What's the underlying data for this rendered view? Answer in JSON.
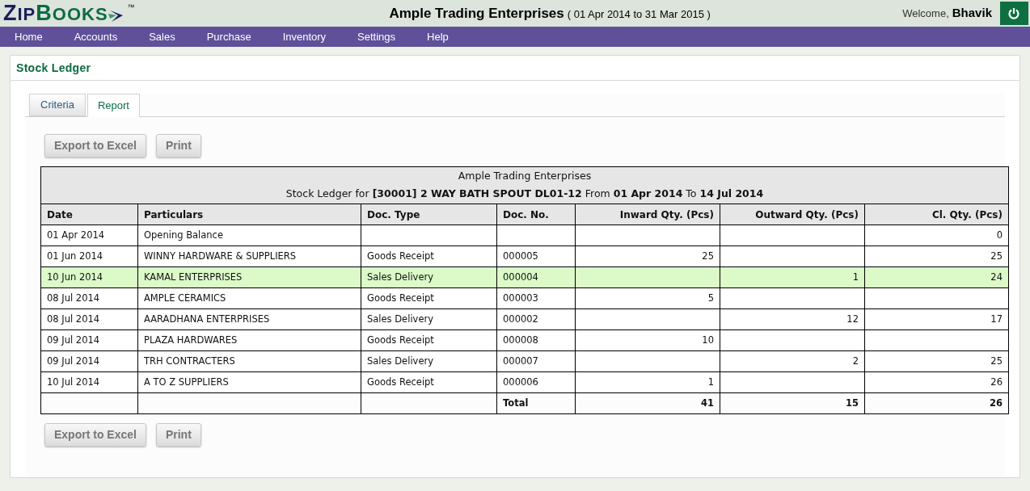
{
  "header": {
    "logo": {
      "first": "ZIP",
      "second": "BOOKS",
      "tm": "™"
    },
    "company": "Ample Trading Enterprises",
    "period": "( 01 Apr 2014 to 31 Mar 2015 )",
    "welcome": "Welcome,",
    "user": "Bhavik"
  },
  "nav": [
    "Home",
    "Accounts",
    "Sales",
    "Purchase",
    "Inventory",
    "Settings",
    "Help"
  ],
  "page_title": "Stock Ledger",
  "tabs": [
    {
      "label": "Criteria",
      "selected": false
    },
    {
      "label": "Report",
      "selected": true
    }
  ],
  "buttons": [
    "Export to Excel",
    "Print"
  ],
  "report": {
    "title": "Ample Trading Enterprises",
    "subtitle": "Stock Ledger for **[30001] 2 WAY BATH SPOUT DL01-12** From **01 Apr 2014** To **14 Jul 2014**",
    "columns": [
      "Date",
      "Particulars",
      "Doc. Type",
      "Doc. No.",
      "Inward Qty. (Pcs)",
      "Outward Qty. (Pcs)",
      "Cl. Qty. (Pcs)"
    ],
    "rows": [
      {
        "date": "01 Apr 2014",
        "particulars": "Opening Balance",
        "closing": "0",
        "selected": false
      },
      {
        "date": "01 Jun 2014",
        "particulars": "WINNY HARDWARE & SUPPLIERS",
        "doc_type": "Goods Receipt",
        "doc_no": "000005",
        "inward": "25",
        "closing": "25",
        "selected": false
      },
      {
        "date": "10 Jun 2014",
        "particulars": "KAMAL ENTERPRISES",
        "doc_type": "Sales Delivery",
        "doc_no": "000004",
        "outward": "1",
        "closing": "24",
        "selected": true
      },
      {
        "date": "08 Jul 2014",
        "particulars": "AMPLE CERAMICS",
        "doc_type": "Goods Receipt",
        "doc_no": "000003",
        "inward": "5",
        "selected": false
      },
      {
        "date": "08 Jul 2014",
        "particulars": "AARADHANA ENTERPRISES",
        "doc_type": "Sales Delivery",
        "doc_no": "000002",
        "outward": "12",
        "closing": "17",
        "selected": false
      },
      {
        "date": "09 Jul 2014",
        "particulars": "PLAZA HARDWARES",
        "doc_type": "Goods Receipt",
        "doc_no": "000008",
        "inward": "10",
        "selected": false
      },
      {
        "date": "09 Jul 2014",
        "particulars": "TRH CONTRACTERS",
        "doc_type": "Sales Delivery",
        "doc_no": "000007",
        "outward": "2",
        "closing": "25",
        "selected": false
      },
      {
        "date": "10 Jul 2014",
        "particulars": "A TO Z SUPPLIERS",
        "doc_type": "Goods Receipt",
        "doc_no": "000006",
        "inward": "1",
        "closing": "26",
        "selected": false
      }
    ],
    "total": {
      "doc_no": "Total",
      "inward": "41",
      "outward": "15",
      "closing": "26"
    }
  },
  "buttons_bottom": [
    "Export to Excel",
    "Print"
  ]
}
